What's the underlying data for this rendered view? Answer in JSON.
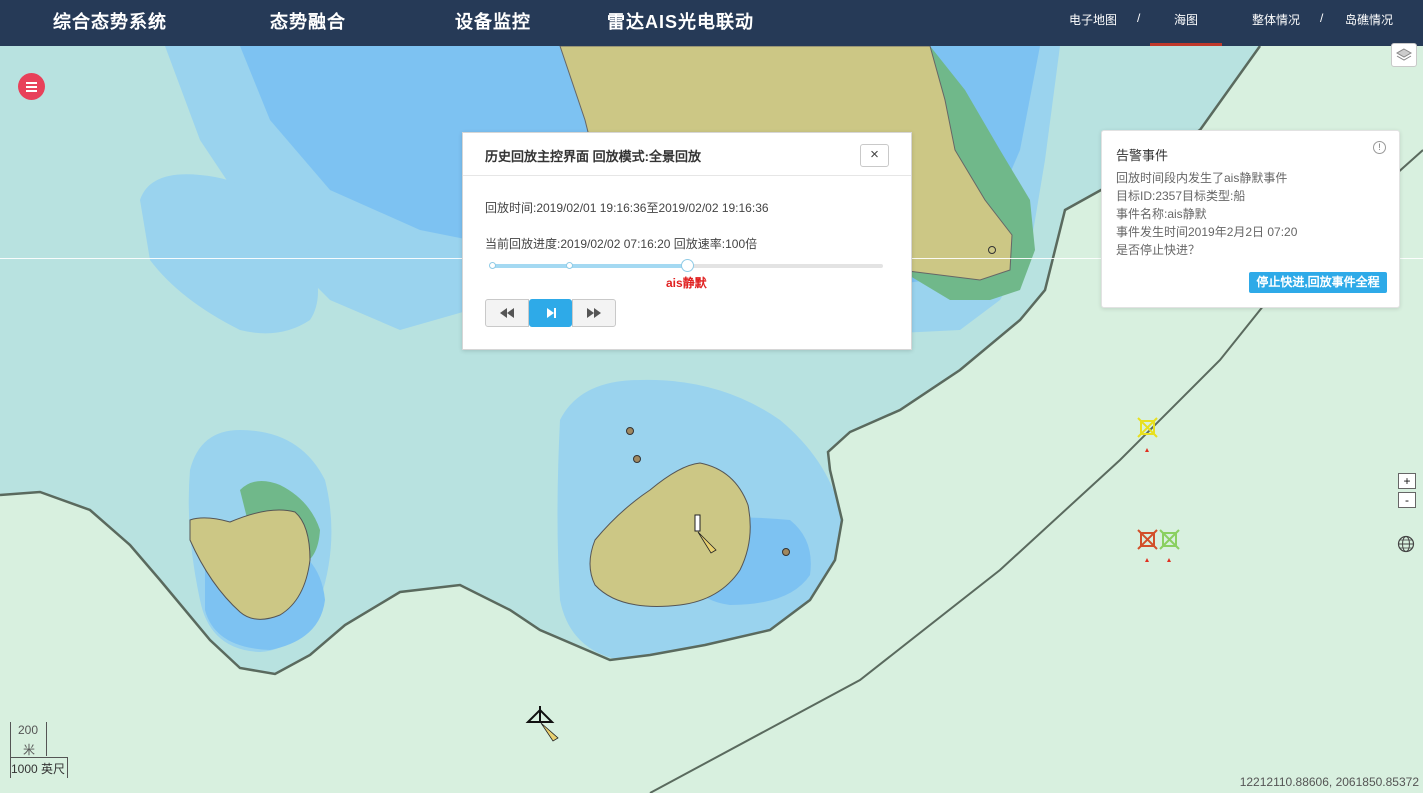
{
  "nav": {
    "main": [
      "综合态势系统",
      "态势融合",
      "设备监控",
      "雷达AIS光电联动"
    ],
    "right": [
      "电子地图",
      "海图",
      "整体情况",
      "岛礁情况"
    ],
    "separator": "/"
  },
  "replay": {
    "title": "历史回放主控界面 回放模式:全景回放",
    "close": "×",
    "time_range": "回放时间:2019/02/01 19:16:36至2019/02/02 19:16:36",
    "progress_text": "当前回放进度:2019/02/02 07:16:20 回放速率:100倍",
    "progress_fraction": 0.5,
    "event_marker_label": "ais静默",
    "controls": [
      "rewind-icon",
      "play-step-icon",
      "fast-forward-icon"
    ]
  },
  "alert": {
    "title": "告警事件",
    "info_icon": "!",
    "lines": [
      "回放时间段内发生了ais静默事件",
      "目标ID:2357目标类型:船",
      "事件名称:ais静默",
      "事件发生时间2019年2月2日 07:20",
      "是否停止快进？"
    ],
    "button": "停止快进,回放事件全程"
  },
  "map": {
    "zoom_in": "+",
    "zoom_out": "-",
    "scale_top": "200",
    "scale_top_unit": "米",
    "scale_bottom": "1000 英尺",
    "coordinates": "12212110.88606, 2061850.85372",
    "colors": {
      "deep_water": "#7dc2f2",
      "mid_water": "#9ad3ee",
      "shallow_water": "#b8e2e0",
      "land": "#ccc785",
      "green_band": "#70b88a",
      "coast_land": "#d8f0df",
      "accent": "#2eaae8",
      "menu_red": "#e8415a"
    }
  }
}
